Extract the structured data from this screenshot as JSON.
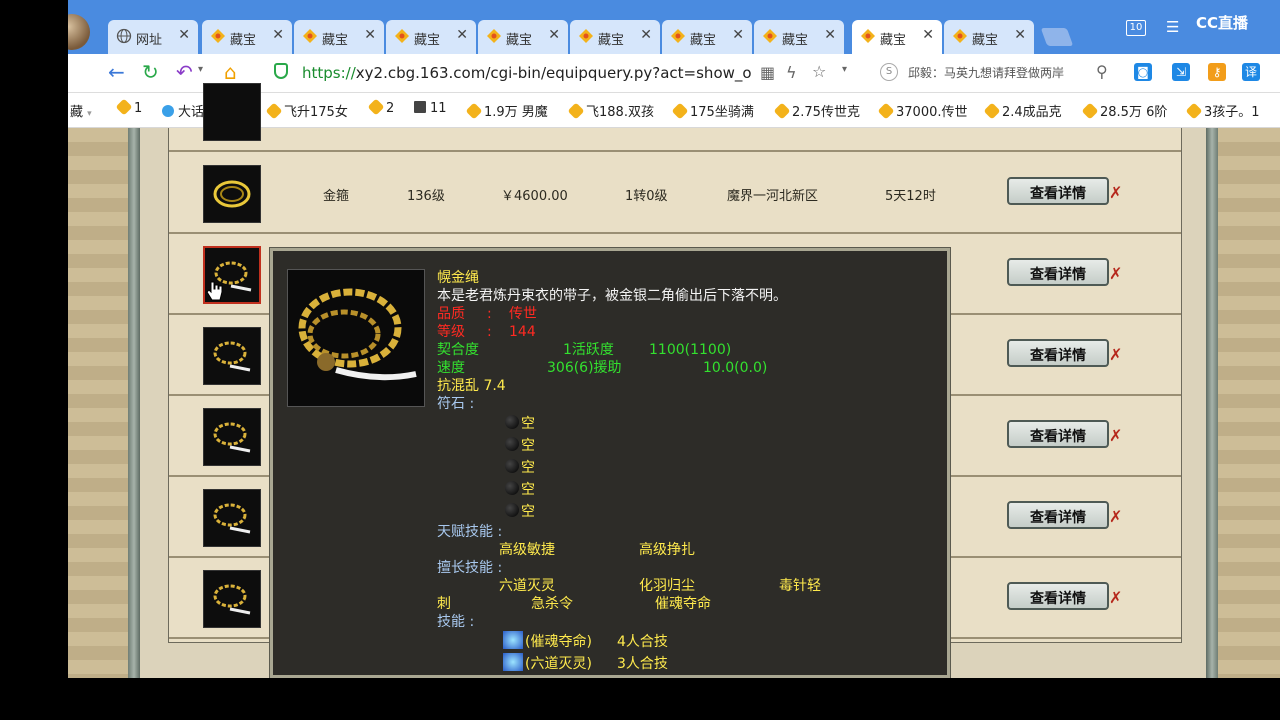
{
  "tabs": [
    {
      "label": "网址"
    },
    {
      "label": "藏宝"
    },
    {
      "label": "藏宝"
    },
    {
      "label": "藏宝"
    },
    {
      "label": "藏宝"
    },
    {
      "label": "藏宝"
    },
    {
      "label": "藏宝"
    },
    {
      "label": "藏宝"
    },
    {
      "label": "藏宝"
    },
    {
      "label": "藏宝"
    }
  ],
  "window": {
    "tab_count": "10",
    "brand": "CC直播"
  },
  "address": {
    "scheme": "https://",
    "rest": "xy2.cbg.163.com/cgi-bin/equipquery.py?act=show_o",
    "search_hint": "邱毅：马英九想请拜登做两岸"
  },
  "bookmarks": [
    {
      "label": "藏"
    },
    {
      "label": "1"
    },
    {
      "label": "大话端游达"
    },
    {
      "label": "飞升175女"
    },
    {
      "label": "2"
    },
    {
      "label": "11"
    },
    {
      "label": "1.9万 男魔"
    },
    {
      "label": "飞188.双孩"
    },
    {
      "label": "175坐骑满"
    },
    {
      "label": "2.75传世克"
    },
    {
      "label": "37000.传世"
    },
    {
      "label": "2.4成品克"
    },
    {
      "label": "28.5万 6阶"
    },
    {
      "label": "3孩子。1"
    }
  ],
  "listing": {
    "rows": [
      {
        "name": "金箍",
        "level": "136级",
        "price": "￥4600.00",
        "reincarnation": "1转0级",
        "server": "魔界一河北新区",
        "time_left": "5天12时",
        "button": "查看详情"
      },
      {
        "button": "查看详情"
      },
      {
        "button": "查看详情"
      },
      {
        "button": "查看详情"
      },
      {
        "button": "查看详情"
      },
      {
        "button": "查看详情"
      }
    ]
  },
  "popup": {
    "name": "幌金绳",
    "desc": "本是老君炼丹束衣的带子，被金银二角偷出后下落不明。",
    "quality_label": "品质",
    "quality_sep": ":",
    "quality_value": "传世",
    "level_label": "等级",
    "level_sep": ":",
    "level_value": "144",
    "fit_label": "契合度",
    "activity_label": "1活跃度",
    "activity_value": "1100(1100)",
    "speed_label": "速度",
    "speed_value": "306(6)援助",
    "assist_value": "10.0(0.0)",
    "anti_chaos": "抗混乱  7.4",
    "rune_label": "符石  :",
    "rune_slots": [
      "空",
      "空",
      "空",
      "空",
      "空"
    ],
    "talent_label": "天赋技能  :",
    "talents": [
      "高级敏捷",
      "高级挣扎"
    ],
    "expert_label": "擅长技能  :",
    "experts_line1": [
      "六道灭灵",
      "化羽归尘",
      "毒针轻"
    ],
    "experts_line2": [
      "刺",
      "急杀令",
      "催魂夺命"
    ],
    "skill_label": "技能  :",
    "skills": [
      {
        "name": "(催魂夺命)",
        "combo": "4人合技"
      },
      {
        "name": "(六道灭灵)",
        "combo": "3人合技"
      }
    ]
  },
  "colors": {
    "accent": "#4a8be0",
    "popup_bg": "#2d2c28",
    "quality": "#ff2a22",
    "attr": "#33e02f",
    "gold": "#ffea4d"
  }
}
